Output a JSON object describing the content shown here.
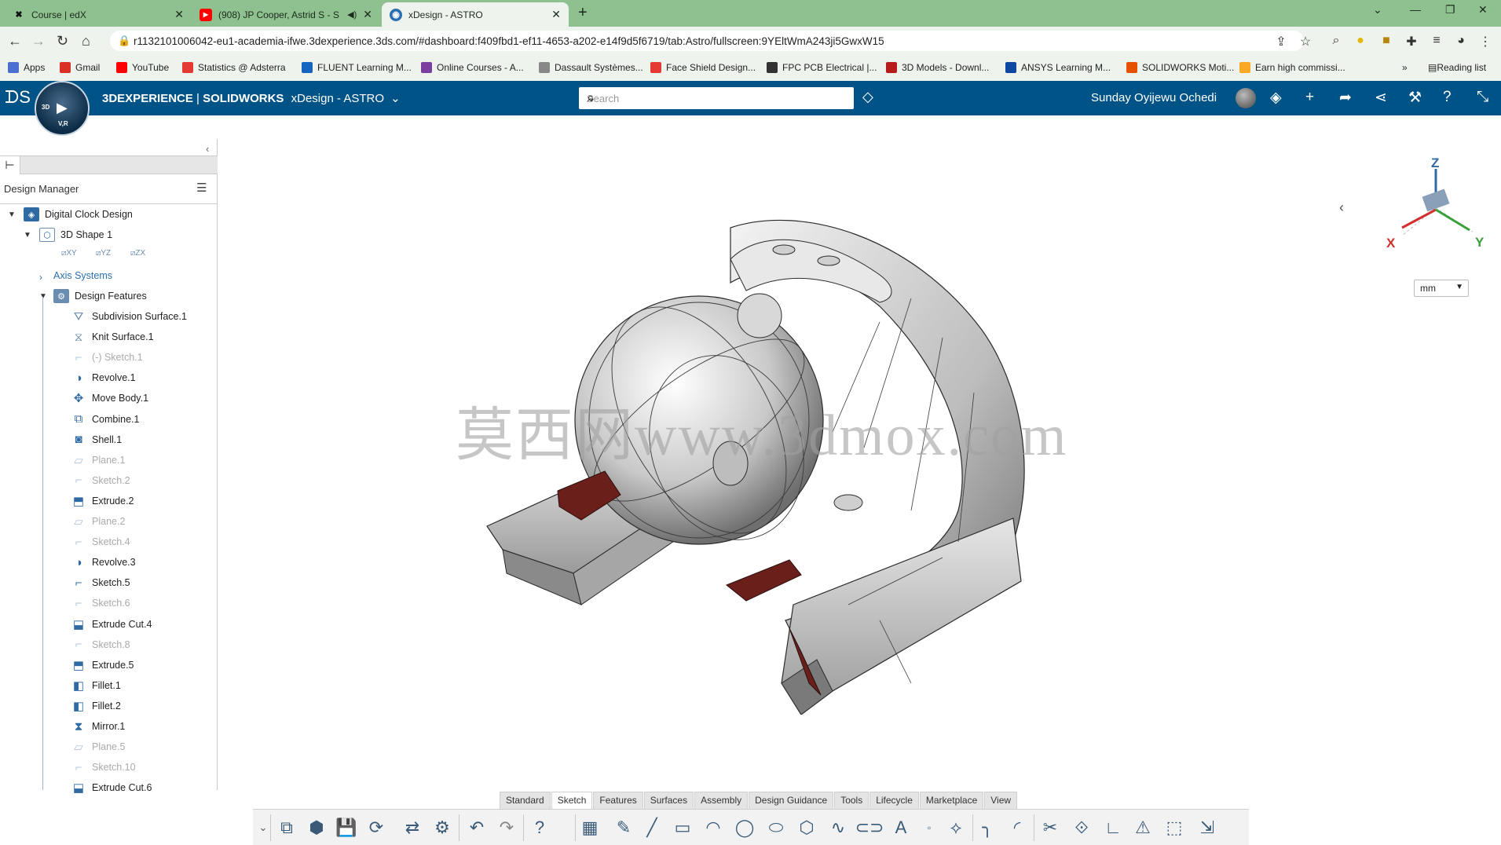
{
  "browser": {
    "tabs": [
      {
        "title": "Course | edX",
        "icon": "X"
      },
      {
        "title": "(908) JP Cooper, Astrid S - S",
        "icon": "▶"
      },
      {
        "title": "xDesign - ASTRO",
        "icon": "◉"
      }
    ],
    "url": "r1132101006042-eu1-academia-ifwe.3dexperience.3ds.com/#dashboard:f409fbd1-ef11-4653-a202-e14f9d5f6719/tab:Astro/fullscreen:9YEltWmA243ji5GwxW15",
    "bookmarks": [
      {
        "label": "Apps",
        "color": "#4a6fd1"
      },
      {
        "label": "Gmail",
        "color": "#d93025"
      },
      {
        "label": "YouTube",
        "color": "#ff0000"
      },
      {
        "label": "Statistics @ Adsterra",
        "color": "#e53935"
      },
      {
        "label": "FLUENT Learning M...",
        "color": "#1565c0"
      },
      {
        "label": "Online Courses - A...",
        "color": "#7b3fa0"
      },
      {
        "label": "Dassault Systèmes...",
        "color": "#888888"
      },
      {
        "label": "Face Shield Design...",
        "color": "#e53935"
      },
      {
        "label": "FPC PCB Electrical |...",
        "color": "#333333"
      },
      {
        "label": "3D Models - Downl...",
        "color": "#b71c1c"
      },
      {
        "label": "ANSYS Learning M...",
        "color": "#0d47a1"
      },
      {
        "label": "SOLIDWORKS Moti...",
        "color": "#e65100"
      },
      {
        "label": "Earn high commissi...",
        "color": "#f9a825"
      }
    ],
    "more_bookmarks": "»",
    "reading_list": "Reading list"
  },
  "app": {
    "brand": "3DEXPERIENCE",
    "separator": " | ",
    "product": "SOLIDWORKS",
    "app_name": "xDesign - ASTRO",
    "search_placeholder": "Search",
    "user_name": "Sunday Oyijewu Ochedi",
    "compass_version": "V,R",
    "compass_3d": "3D"
  },
  "design_manager": {
    "title": "Design Manager",
    "root": "Digital Clock Design",
    "shape": "3D Shape 1",
    "axis_systems": "Axis Systems",
    "design_features": "Design Features",
    "features": [
      {
        "label": "Subdivision Surface.1",
        "dim": false,
        "icon": "subd",
        "color": "#6a8db0"
      },
      {
        "label": "Knit Surface.1",
        "dim": false,
        "icon": "knit",
        "color": "#6a8db0"
      },
      {
        "label": "(-)  Sketch.1",
        "dim": true,
        "icon": "sketch",
        "color": "#b0c4d8"
      },
      {
        "label": "Revolve.1",
        "dim": false,
        "icon": "revolve",
        "color": "#2f6aa3"
      },
      {
        "label": "Move Body.1",
        "dim": false,
        "icon": "move",
        "color": "#2f6aa3"
      },
      {
        "label": "Combine.1",
        "dim": false,
        "icon": "combine",
        "color": "#2f6aa3"
      },
      {
        "label": "Shell.1",
        "dim": false,
        "icon": "shell",
        "color": "#2f6aa3"
      },
      {
        "label": "Plane.1",
        "dim": true,
        "icon": "plane",
        "color": "#b0c4d8"
      },
      {
        "label": "Sketch.2",
        "dim": true,
        "icon": "sketch",
        "color": "#b0c4d8"
      },
      {
        "label": "Extrude.2",
        "dim": false,
        "icon": "extrude",
        "color": "#2f6aa3"
      },
      {
        "label": "Plane.2",
        "dim": true,
        "icon": "plane",
        "color": "#b0c4d8"
      },
      {
        "label": "Sketch.4",
        "dim": true,
        "icon": "sketch",
        "color": "#b0c4d8"
      },
      {
        "label": "Revolve.3",
        "dim": false,
        "icon": "revolve",
        "color": "#2f6aa3"
      },
      {
        "label": "Sketch.5",
        "dim": false,
        "icon": "sketch",
        "color": "#2f6aa3"
      },
      {
        "label": "Sketch.6",
        "dim": true,
        "icon": "sketch",
        "color": "#b0c4d8"
      },
      {
        "label": "Extrude Cut.4",
        "dim": false,
        "icon": "cut",
        "color": "#2f6aa3"
      },
      {
        "label": "Sketch.8",
        "dim": true,
        "icon": "sketch",
        "color": "#b0c4d8"
      },
      {
        "label": "Extrude.5",
        "dim": false,
        "icon": "extrude",
        "color": "#2f6aa3"
      },
      {
        "label": "Fillet.1",
        "dim": false,
        "icon": "fillet",
        "color": "#2f6aa3"
      },
      {
        "label": "Fillet.2",
        "dim": false,
        "icon": "fillet",
        "color": "#2f6aa3"
      },
      {
        "label": "Mirror.1",
        "dim": false,
        "icon": "mirror",
        "color": "#2f6aa3"
      },
      {
        "label": "Plane.5",
        "dim": true,
        "icon": "plane",
        "color": "#b0c4d8"
      },
      {
        "label": "Sketch.10",
        "dim": true,
        "icon": "sketch",
        "color": "#b0c4d8"
      },
      {
        "label": "Extrude Cut.6",
        "dim": false,
        "icon": "cut",
        "color": "#2f6aa3"
      }
    ]
  },
  "viewport": {
    "watermark": "莫西网www.3dmox.com",
    "units": "mm",
    "triad": {
      "x": "X",
      "y": "Y",
      "z": "Z"
    }
  },
  "toolbar_tabs": [
    "Standard",
    "Sketch",
    "Features",
    "Surfaces",
    "Assembly",
    "Design Guidance",
    "Tools",
    "Lifecycle",
    "Marketplace",
    "View"
  ],
  "toolbar_active": "Sketch",
  "colors": {
    "appbar": "#005386",
    "tabstrip": "#8fc08f",
    "link": "#2a6fb1",
    "model_accent": "#6b1f1a"
  }
}
